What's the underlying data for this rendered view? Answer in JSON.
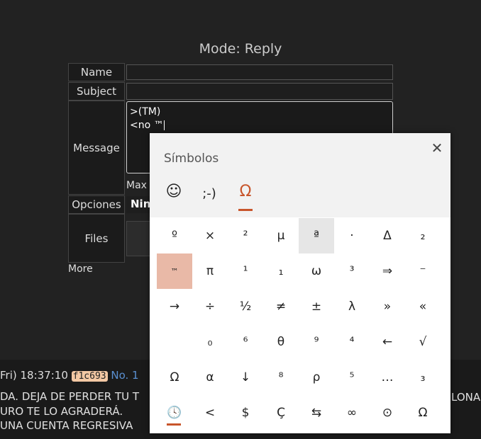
{
  "mode_title": "Mode: Reply",
  "form": {
    "name_label": "Name",
    "subject_label": "Subject",
    "message_label": "Message",
    "message_line1": ">(TM)",
    "message_line2": "<no ™",
    "max_label": "Max",
    "options_label": "Opciones",
    "options_value": "Ning",
    "files_label": "Files",
    "more_label": "More"
  },
  "post": {
    "time": "Fri) 18:37:10",
    "hash": "f1c693",
    "no": "No. 1",
    "line1": "DA. DEJA DE PERDER TU T",
    "line1_right": "LONAS",
    "line2": "URO TE LO AGRADERÁ.",
    "line3": "UNA CUENTA REGRESIVA"
  },
  "panel": {
    "title": "Símbolos",
    "close_glyph": "✕",
    "tabs": [
      {
        "name": "emoji-tab",
        "glyph": "☺"
      },
      {
        "name": "kaomoji-tab",
        "glyph": ";-)"
      },
      {
        "name": "symbols-tab",
        "glyph": "Ω"
      }
    ],
    "rows": [
      [
        "º",
        "×",
        "²",
        "µ",
        "ª",
        "·",
        "Δ",
        "₂"
      ],
      [
        "™",
        "π",
        "¹",
        "₁",
        "ω",
        "³",
        "⇒",
        "⁻"
      ],
      [
        "→",
        "÷",
        "½",
        "≠",
        "±",
        "λ",
        "»",
        "«"
      ],
      [
        " ",
        "₀",
        "⁶",
        "θ",
        "⁹",
        "⁴",
        "←",
        "√"
      ],
      [
        "Ω",
        "α",
        "↓",
        "⁸",
        "ρ",
        "⁵",
        "…",
        "₃"
      ]
    ],
    "footer": [
      "🕓",
      "<",
      "$",
      "Ç",
      "⇆",
      "∞",
      "⊙",
      "Ω"
    ]
  }
}
